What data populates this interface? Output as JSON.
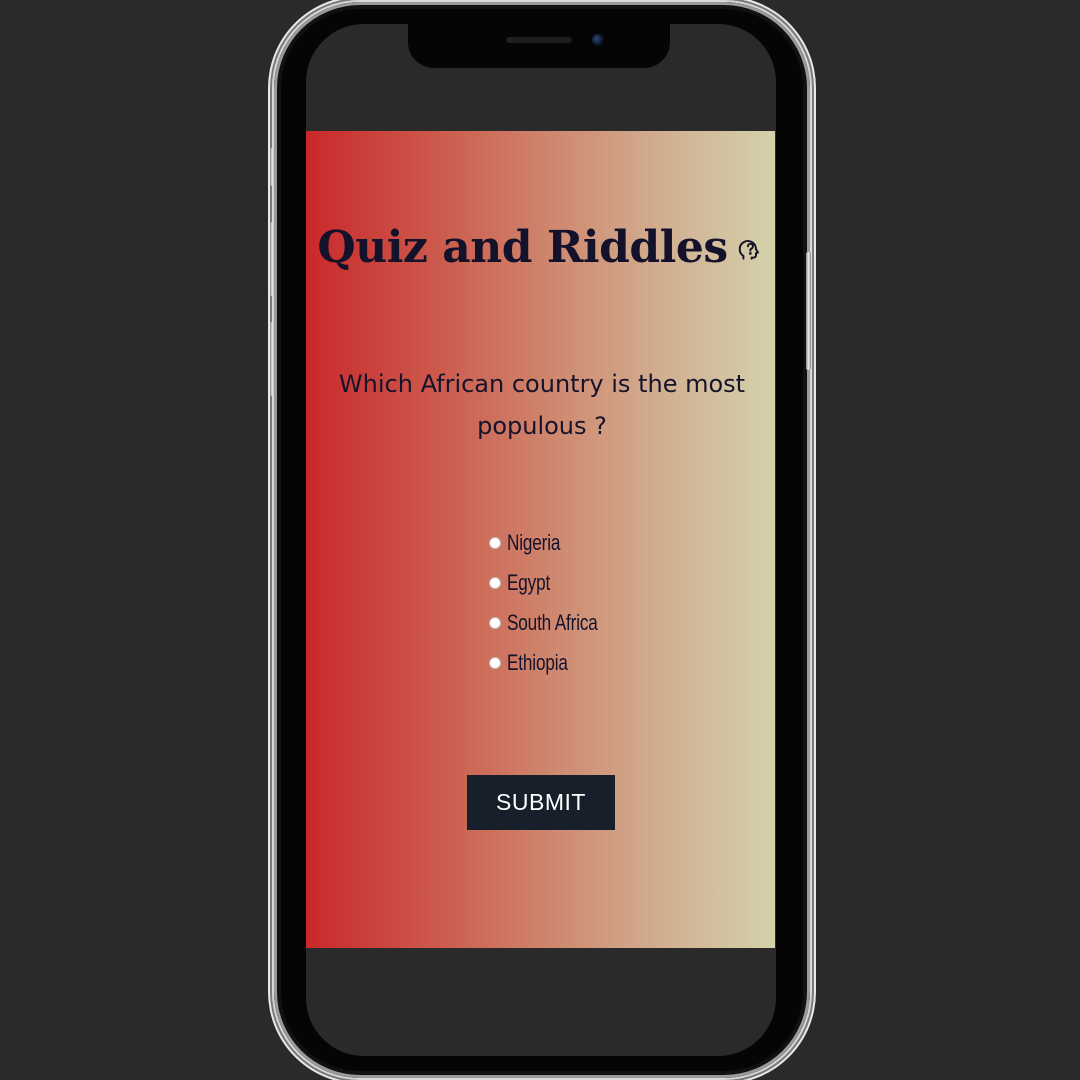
{
  "app": {
    "title": "Quiz and Riddles",
    "title_icon": "head-question-icon"
  },
  "quiz": {
    "question": "Which African country is the most populous ?",
    "options": [
      {
        "label": "Nigeria",
        "selected": false
      },
      {
        "label": "Egypt",
        "selected": false
      },
      {
        "label": "South Africa",
        "selected": false
      },
      {
        "label": "Ethiopia",
        "selected": false
      }
    ],
    "submit_label": "SUBMIT"
  },
  "colors": {
    "gradient_start": "#c9282a",
    "gradient_end": "#d3d1ab",
    "text": "#16132c",
    "button_bg": "#17202a",
    "button_text": "#ffffff",
    "page_bg": "#2a2a2a"
  }
}
